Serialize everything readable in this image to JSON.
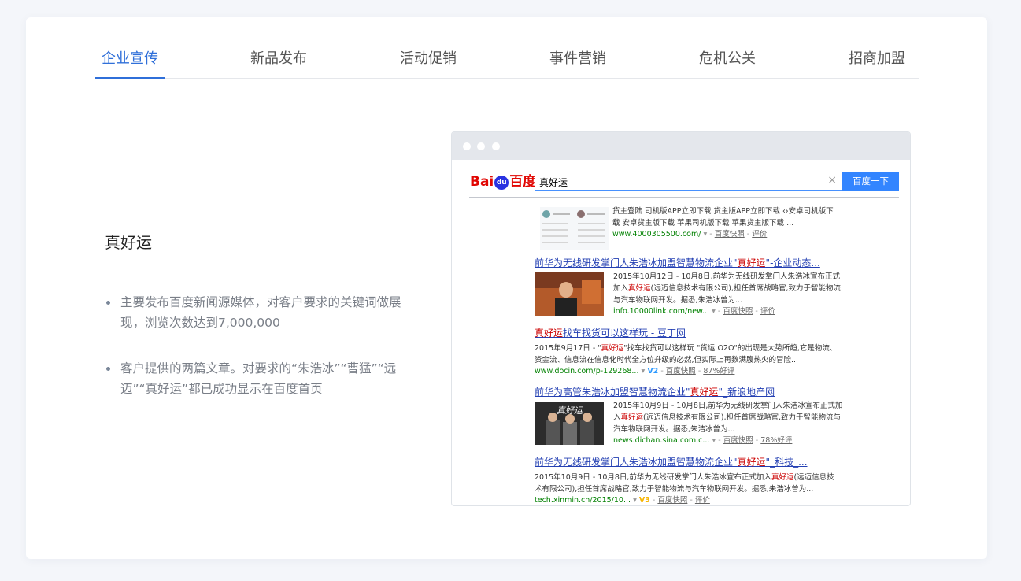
{
  "tabs": [
    {
      "label": "企业宣传",
      "active": true
    },
    {
      "label": "新品发布",
      "active": false
    },
    {
      "label": "活动促销",
      "active": false
    },
    {
      "label": "事件营销",
      "active": false
    },
    {
      "label": "危机公关",
      "active": false
    },
    {
      "label": "招商加盟",
      "active": false
    }
  ],
  "case": {
    "title": "真好运",
    "bullets": [
      "主要发布百度新闻源媒体，对客户要求的关键词做展现，浏览次数达到7,000,000",
      "客户提供的两篇文章。对要求的“朱浩冰”“曹猛”“远迈”“真好运”都已成功显示在百度首页"
    ]
  },
  "baidu": {
    "logo_left": "Bai",
    "logo_paw": "du",
    "logo_right": "百度",
    "query": "真好运",
    "search_button": "百度一下",
    "clear_icon": "×",
    "results": {
      "r0": {
        "line1": "货主登陆 司机版APP立即下载 货主版APP立即下载 ‹›安卓司机版下",
        "line2": "载 安卓货主版下载 苹果司机版下载 苹果货主版下载 ...",
        "url": "www.4000305500.com/",
        "snap": "百度快照",
        "extra": "评价"
      },
      "r1": {
        "title_a": "前华为无线研发掌门人朱浩冰加盟智慧物流企业\"",
        "title_hl": "真好运",
        "title_b": "\"-企业动态...",
        "text_a": "2015年10月12日 - 10月8日,前华为无线研发掌门人朱浩冰宣布正式加入",
        "text_hl": "真好运",
        "text_b": "(远迈信息技术有限公司),担任首席战略官,致力于智能物流与汽车物联网开发。据悉,朱浩冰曾为...",
        "url": "info.10000link.com/new...",
        "snap": "百度快照",
        "extra": "评价"
      },
      "r2": {
        "title_hl": "真好运",
        "title_b": "找车找货可以这样玩 - 豆丁网",
        "text_a": "2015年9月17日 - \"",
        "text_hl": "真好运",
        "text_b": "\"找车找货可以这样玩 \"货运 O2O\"的出现是大势所趋,它是物流、资金流、信息流在信息化时代全方位升级的必然,但实际上再数满腹热火的冒险...",
        "url": "www.docin.com/p-129268...",
        "badge": "V2",
        "snap": "百度快照",
        "extra": "87%好评"
      },
      "r3": {
        "title_a": "前华为高管朱浩冰加盟智慧物流企业\"",
        "title_hl": "真好运",
        "title_b": "\"_新浪地产网",
        "text_a": "2015年10月9日 - 10月8日,前华为无线研发掌门人朱浩冰宣布正式加入",
        "text_hl": "真好运",
        "text_b": "(远迈信息技术有限公司),担任首席战略官,致力于智能物流与汽车物联网开发。据悉,朱浩冰曾为...",
        "thumb_text": "真好运",
        "url": "news.dichan.sina.com.c...",
        "snap": "百度快照",
        "extra": "78%好评"
      },
      "r4": {
        "title_a": "前华为无线研发掌门人朱浩冰加盟智慧物流企业\"",
        "title_hl": "真好运",
        "title_b": "\"_科技_...",
        "text_a": "2015年10月9日 - 10月8日,前华为无线研发掌门人朱浩冰宣布正式加入",
        "text_hl": "真好运",
        "text_b": "(远迈信息技术有限公司),担任首席战略官,致力于智能物流与汽车物联网开发。据悉,朱浩冰曾为...",
        "url": "tech.xinmin.cn/2015/10...",
        "badge": "V3",
        "snap": "百度快照",
        "extra": "评价"
      }
    }
  }
}
